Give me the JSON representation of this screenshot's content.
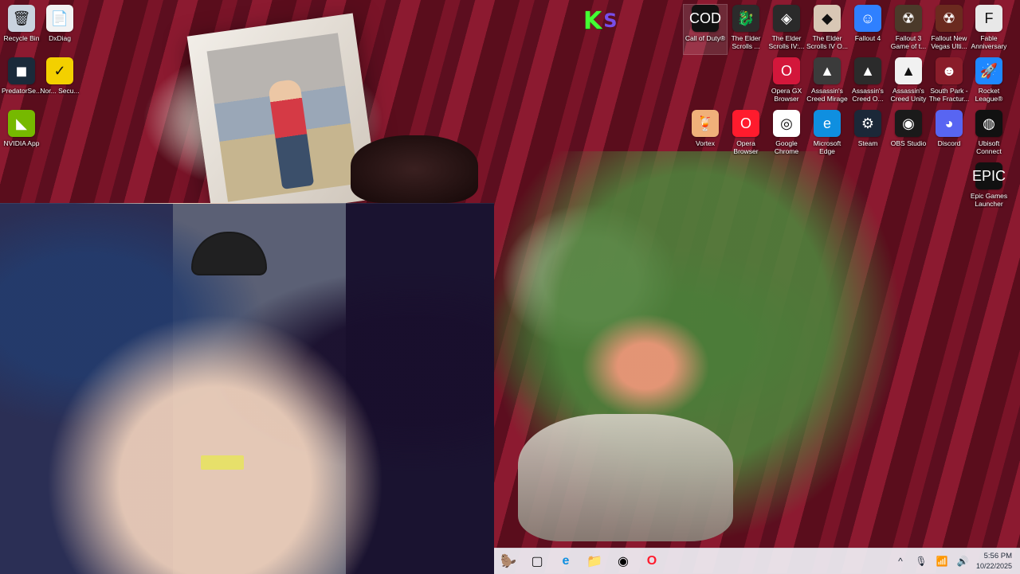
{
  "desktop": {
    "left_icons": [
      {
        "label": "Recycle Bin",
        "icon": "recycle-bin-icon",
        "glyph": "🗑",
        "color": "#c9d3df"
      },
      {
        "label": "DxDiag",
        "icon": "dxdiag-icon",
        "glyph": "📄",
        "color": "#f2f2f2"
      },
      {
        "label": "PredatorSe...",
        "icon": "predatorsense-icon",
        "glyph": "◼",
        "color": "#1a2a3a"
      },
      {
        "label": "Nor... Secu...",
        "icon": "norton-icon",
        "glyph": "✓",
        "color": "#f3d000"
      },
      {
        "label": "NVIDIA App",
        "icon": "nvidia-icon",
        "glyph": "◣",
        "color": "#76b900"
      }
    ],
    "top_right_icons": [
      {
        "label": "Call of Duty®",
        "icon": "call-of-duty-icon",
        "glyph": "COD",
        "color": "#111111"
      },
      {
        "label": "The Elder Scrolls ...",
        "icon": "elder-scrolls-icon",
        "glyph": "🐉",
        "color": "#2b2b2b"
      },
      {
        "label": "The Elder Scrolls IV:...",
        "icon": "oblivion-icon",
        "glyph": "◈",
        "color": "#2a2a2a"
      },
      {
        "label": "The Elder Scrolls IV O...",
        "icon": "oblivion-remastered-icon",
        "glyph": "◆",
        "color": "#d8c7b5"
      },
      {
        "label": "Fallout 4",
        "icon": "fallout4-icon",
        "glyph": "☺",
        "color": "#2f80ff"
      },
      {
        "label": "Fallout 3 Game of t...",
        "icon": "fallout3-icon",
        "glyph": "☢",
        "color": "#4b3a2a"
      },
      {
        "label": "Fallout New Vegas Ulti...",
        "icon": "fallout-new-vegas-icon",
        "glyph": "☢",
        "color": "#6b2a1f"
      },
      {
        "label": "Fable Anniversary",
        "icon": "fable-icon",
        "glyph": "F",
        "color": "#e8e8e8"
      },
      {
        "label": "Opera GX Browser",
        "icon": "opera-gx-icon",
        "glyph": "O",
        "color": "#d3173b"
      },
      {
        "label": "Assassin's Creed Mirage",
        "icon": "assassins-creed-mirage-icon",
        "glyph": "▲",
        "color": "#3b3b3b"
      },
      {
        "label": "Assassin's Creed O...",
        "icon": "assassins-creed-origins-icon",
        "glyph": "▲",
        "color": "#2b2b2b"
      },
      {
        "label": "Assassin's Creed Unity",
        "icon": "assassins-creed-unity-icon",
        "glyph": "▲",
        "color": "#f1f1f1"
      },
      {
        "label": "South Park - The Fractur...",
        "icon": "south-park-icon",
        "glyph": "☻",
        "color": "#8a1d2a"
      },
      {
        "label": "Rocket League®",
        "icon": "rocket-league-icon",
        "glyph": "🚀",
        "color": "#1e88ff"
      },
      {
        "label": "Vortex",
        "icon": "vortex-icon",
        "glyph": "🍹",
        "color": "#f0b07a"
      },
      {
        "label": "Opera Browser",
        "icon": "opera-browser-icon",
        "glyph": "O",
        "color": "#ff1b2d"
      },
      {
        "label": "Google Chrome",
        "icon": "google-chrome-icon",
        "glyph": "◎",
        "color": "#ffffff"
      },
      {
        "label": "Microsoft Edge",
        "icon": "microsoft-edge-icon",
        "glyph": "e",
        "color": "#0f8fe0"
      },
      {
        "label": "Steam",
        "icon": "steam-icon",
        "glyph": "⚙",
        "color": "#1b2838"
      },
      {
        "label": "OBS Studio",
        "icon": "obs-studio-icon",
        "glyph": "◉",
        "color": "#1a1a1a"
      },
      {
        "label": "Discord",
        "icon": "discord-icon",
        "glyph": "◕",
        "color": "#5865f2"
      },
      {
        "label": "Ubisoft Connect",
        "icon": "ubisoft-connect-icon",
        "glyph": "◍",
        "color": "#111111"
      },
      {
        "label": "Epic Games Launcher",
        "icon": "epic-games-icon",
        "glyph": "EPIC",
        "color": "#111111"
      }
    ]
  },
  "taskbar": {
    "apps": [
      {
        "name": "beaver-icon",
        "glyph": "🦫"
      },
      {
        "name": "task-view-icon",
        "glyph": "▢"
      },
      {
        "name": "edge-taskbar-icon",
        "glyph": "e"
      },
      {
        "name": "file-explorer-icon",
        "glyph": "📁"
      },
      {
        "name": "obs-taskbar-icon",
        "glyph": "◉"
      },
      {
        "name": "opera-taskbar-icon",
        "glyph": "O"
      }
    ],
    "tray": {
      "chevron": "^",
      "mic": "🎙",
      "wifi": "📶",
      "volume": "🔊",
      "time": "5:56 PM",
      "date": "10/22/2025"
    }
  },
  "overlay": {
    "k": "K",
    "s": "S"
  }
}
